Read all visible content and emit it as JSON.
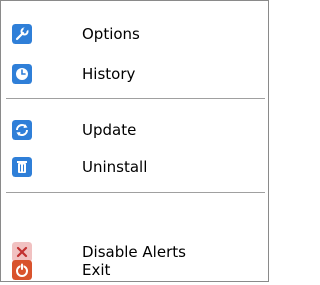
{
  "menu": {
    "items": [
      {
        "label": "Options",
        "icon": "wrench-icon",
        "color": "#2f7fd8"
      },
      {
        "label": "History",
        "icon": "clock-icon",
        "color": "#2f7fd8"
      },
      {
        "label": "Update",
        "icon": "refresh-icon",
        "color": "#2f7fd8"
      },
      {
        "label": "Uninstall",
        "icon": "trash-icon",
        "color": "#2f7fd8"
      },
      {
        "label": "Disable Alerts",
        "icon": "disable-icon",
        "color": "#f1c1c1"
      },
      {
        "label": "Exit",
        "icon": "power-icon",
        "color": "#d9532d"
      }
    ]
  }
}
